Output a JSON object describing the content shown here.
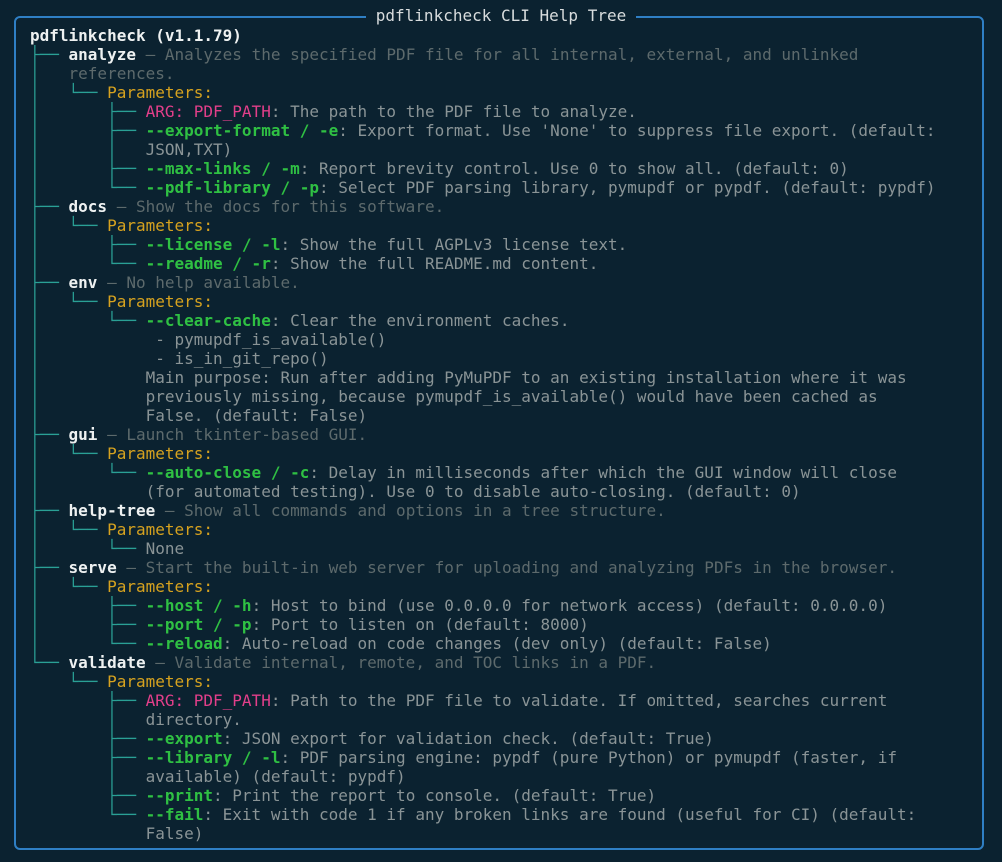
{
  "title": "pdflinkcheck CLI Help Tree",
  "root_label": "pdflinkcheck (v1.1.79)",
  "params_label": "Parameters:",
  "lines": [
    {
      "indent": "",
      "g": "",
      "parts": [
        {
          "c": "cmd",
          "t": "pdflinkcheck (v1.1.79)"
        }
      ]
    },
    {
      "indent": "",
      "g": "├── ",
      "parts": [
        {
          "c": "cmd",
          "t": "analyze"
        },
        {
          "c": "dim",
          "t": " – Analyzes the specified PDF file for all internal, external, and unlinked"
        }
      ]
    },
    {
      "indent": "",
      "g": "│   ",
      "parts": [
        {
          "c": "dim",
          "t": "references."
        }
      ]
    },
    {
      "indent": "",
      "g": "│   └── ",
      "parts": [
        {
          "c": "par",
          "t": "Parameters:"
        }
      ]
    },
    {
      "indent": "",
      "g": "│       ├── ",
      "parts": [
        {
          "c": "arg",
          "t": "ARG: PDF_PATH"
        },
        {
          "c": "txt",
          "t": ": The path to the PDF file to analyze."
        }
      ]
    },
    {
      "indent": "",
      "g": "│       ├── ",
      "parts": [
        {
          "c": "opt",
          "t": "--export-format / -e"
        },
        {
          "c": "txt",
          "t": ": Export format. Use 'None' to suppress file export. (default:"
        }
      ]
    },
    {
      "indent": "",
      "g": "│       │   ",
      "parts": [
        {
          "c": "txt",
          "t": "JSON,TXT)"
        }
      ]
    },
    {
      "indent": "",
      "g": "│       ├── ",
      "parts": [
        {
          "c": "opt",
          "t": "--max-links / -m"
        },
        {
          "c": "txt",
          "t": ": Report brevity control. Use 0 to show all. (default: 0)"
        }
      ]
    },
    {
      "indent": "",
      "g": "│       └── ",
      "parts": [
        {
          "c": "opt",
          "t": "--pdf-library / -p"
        },
        {
          "c": "txt",
          "t": ": Select PDF parsing library, pymupdf or pypdf. (default: pypdf)"
        }
      ]
    },
    {
      "indent": "",
      "g": "├── ",
      "parts": [
        {
          "c": "cmd",
          "t": "docs"
        },
        {
          "c": "dim",
          "t": " – Show the docs for this software."
        }
      ]
    },
    {
      "indent": "",
      "g": "│   └── ",
      "parts": [
        {
          "c": "par",
          "t": "Parameters:"
        }
      ]
    },
    {
      "indent": "",
      "g": "│       ├── ",
      "parts": [
        {
          "c": "opt",
          "t": "--license / -l"
        },
        {
          "c": "txt",
          "t": ": Show the full AGPLv3 license text."
        }
      ]
    },
    {
      "indent": "",
      "g": "│       └── ",
      "parts": [
        {
          "c": "opt",
          "t": "--readme / -r"
        },
        {
          "c": "txt",
          "t": ": Show the full README.md content."
        }
      ]
    },
    {
      "indent": "",
      "g": "├── ",
      "parts": [
        {
          "c": "cmd",
          "t": "env"
        },
        {
          "c": "dim",
          "t": " – No help available."
        }
      ]
    },
    {
      "indent": "",
      "g": "│   └── ",
      "parts": [
        {
          "c": "par",
          "t": "Parameters:"
        }
      ]
    },
    {
      "indent": "",
      "g": "│       └── ",
      "parts": [
        {
          "c": "opt",
          "t": "--clear-cache"
        },
        {
          "c": "txt",
          "t": ": Clear the environment caches."
        }
      ]
    },
    {
      "indent": "",
      "g": "│           ",
      "parts": [
        {
          "c": "txt",
          "t": " - pymupdf_is_available()"
        }
      ]
    },
    {
      "indent": "",
      "g": "│           ",
      "parts": [
        {
          "c": "txt",
          "t": " - is_in_git_repo()"
        }
      ]
    },
    {
      "indent": "",
      "g": "│           ",
      "parts": [
        {
          "c": "txt",
          "t": "Main purpose: Run after adding PyMuPDF to an existing installation where it was"
        }
      ]
    },
    {
      "indent": "",
      "g": "│           ",
      "parts": [
        {
          "c": "txt",
          "t": "previously missing, because pymupdf_is_available() would have been cached as"
        }
      ]
    },
    {
      "indent": "",
      "g": "│           ",
      "parts": [
        {
          "c": "txt",
          "t": "False. (default: False)"
        }
      ]
    },
    {
      "indent": "",
      "g": "├── ",
      "parts": [
        {
          "c": "cmd",
          "t": "gui"
        },
        {
          "c": "dim",
          "t": " – Launch tkinter-based GUI."
        }
      ]
    },
    {
      "indent": "",
      "g": "│   └── ",
      "parts": [
        {
          "c": "par",
          "t": "Parameters:"
        }
      ]
    },
    {
      "indent": "",
      "g": "│       └── ",
      "parts": [
        {
          "c": "opt",
          "t": "--auto-close / -c"
        },
        {
          "c": "txt",
          "t": ": Delay in milliseconds after which the GUI window will close"
        }
      ]
    },
    {
      "indent": "",
      "g": "│           ",
      "parts": [
        {
          "c": "txt",
          "t": "(for automated testing). Use 0 to disable auto-closing. (default: 0)"
        }
      ]
    },
    {
      "indent": "",
      "g": "├── ",
      "parts": [
        {
          "c": "cmd",
          "t": "help-tree"
        },
        {
          "c": "dim",
          "t": " – Show all commands and options in a tree structure."
        }
      ]
    },
    {
      "indent": "",
      "g": "│   └── ",
      "parts": [
        {
          "c": "par",
          "t": "Parameters:"
        }
      ]
    },
    {
      "indent": "",
      "g": "│       └── ",
      "parts": [
        {
          "c": "txt",
          "t": "None"
        }
      ]
    },
    {
      "indent": "",
      "g": "├── ",
      "parts": [
        {
          "c": "cmd",
          "t": "serve"
        },
        {
          "c": "dim",
          "t": " – Start the built-in web server for uploading and analyzing PDFs in the browser."
        }
      ]
    },
    {
      "indent": "",
      "g": "│   └── ",
      "parts": [
        {
          "c": "par",
          "t": "Parameters:"
        }
      ]
    },
    {
      "indent": "",
      "g": "│       ├── ",
      "parts": [
        {
          "c": "opt",
          "t": "--host / -h"
        },
        {
          "c": "txt",
          "t": ": Host to bind (use 0.0.0.0 for network access) (default: 0.0.0.0)"
        }
      ]
    },
    {
      "indent": "",
      "g": "│       ├── ",
      "parts": [
        {
          "c": "opt",
          "t": "--port / -p"
        },
        {
          "c": "txt",
          "t": ": Port to listen on (default: 8000)"
        }
      ]
    },
    {
      "indent": "",
      "g": "│       └── ",
      "parts": [
        {
          "c": "opt",
          "t": "--reload"
        },
        {
          "c": "txt",
          "t": ": Auto-reload on code changes (dev only) (default: False)"
        }
      ]
    },
    {
      "indent": "",
      "g": "└── ",
      "parts": [
        {
          "c": "cmd",
          "t": "validate"
        },
        {
          "c": "dim",
          "t": " – Validate internal, remote, and TOC links in a PDF."
        }
      ]
    },
    {
      "indent": "",
      "g": "    └── ",
      "parts": [
        {
          "c": "par",
          "t": "Parameters:"
        }
      ]
    },
    {
      "indent": "",
      "g": "        ├── ",
      "parts": [
        {
          "c": "arg",
          "t": "ARG: PDF_PATH"
        },
        {
          "c": "txt",
          "t": ": Path to the PDF file to validate. If omitted, searches current"
        }
      ]
    },
    {
      "indent": "",
      "g": "        │   ",
      "parts": [
        {
          "c": "txt",
          "t": "directory."
        }
      ]
    },
    {
      "indent": "",
      "g": "        ├── ",
      "parts": [
        {
          "c": "opt",
          "t": "--export"
        },
        {
          "c": "txt",
          "t": ": JSON export for validation check. (default: True)"
        }
      ]
    },
    {
      "indent": "",
      "g": "        ├── ",
      "parts": [
        {
          "c": "opt",
          "t": "--library / -l"
        },
        {
          "c": "txt",
          "t": ": PDF parsing engine: pypdf (pure Python) or pymupdf (faster, if"
        }
      ]
    },
    {
      "indent": "",
      "g": "        │   ",
      "parts": [
        {
          "c": "txt",
          "t": "available) (default: pypdf)"
        }
      ]
    },
    {
      "indent": "",
      "g": "        ├── ",
      "parts": [
        {
          "c": "opt",
          "t": "--print"
        },
        {
          "c": "txt",
          "t": ": Print the report to console. (default: True)"
        }
      ]
    },
    {
      "indent": "",
      "g": "        └── ",
      "parts": [
        {
          "c": "opt",
          "t": "--fail"
        },
        {
          "c": "txt",
          "t": ": Exit with code 1 if any broken links are found (useful for CI) (default:"
        }
      ]
    },
    {
      "indent": "",
      "g": "            ",
      "parts": [
        {
          "c": "txt",
          "t": "False)"
        }
      ]
    }
  ],
  "colors": {
    "background": "#0b2230",
    "border": "#2f7fc4",
    "tree_guides": "#2aa095",
    "command": "#eef1f1",
    "parameters": "#d6a21f",
    "option": "#2fc043",
    "argument": "#e23f8a",
    "description": "#8a9496"
  }
}
